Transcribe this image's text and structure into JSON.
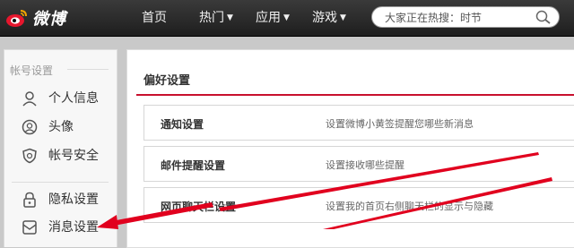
{
  "header": {
    "logo_text": "微博",
    "nav": [
      {
        "label": "首页",
        "has_dropdown": false
      },
      {
        "label": "热门",
        "has_dropdown": true
      },
      {
        "label": "应用",
        "has_dropdown": true
      },
      {
        "label": "游戏",
        "has_dropdown": true
      }
    ],
    "search": {
      "placeholder": "大家正在热搜：时节"
    }
  },
  "sidebar": {
    "section_title": "帐号设置",
    "items": [
      {
        "label": "个人信息",
        "icon": "user-icon"
      },
      {
        "label": "头像",
        "icon": "avatar-icon"
      },
      {
        "label": "帐号安全",
        "icon": "shield-icon"
      },
      {
        "label": "隐私设置",
        "icon": "lock-icon"
      },
      {
        "label": "消息设置",
        "icon": "message-icon"
      }
    ]
  },
  "content": {
    "title": "偏好设置",
    "rows": [
      {
        "label": "通知设置",
        "description": "设置微博小黄签提醒您哪些新消息"
      },
      {
        "label": "邮件提醒设置",
        "description": "设置接收哪些提醒"
      },
      {
        "label": "网页聊天栏设置",
        "description": "设置我的首页右侧聊天栏的显示与隐藏"
      }
    ]
  },
  "colors": {
    "accent": "#c8102e",
    "topbar": "#2a2a2a",
    "annotation_arrow": "#e1001e"
  }
}
